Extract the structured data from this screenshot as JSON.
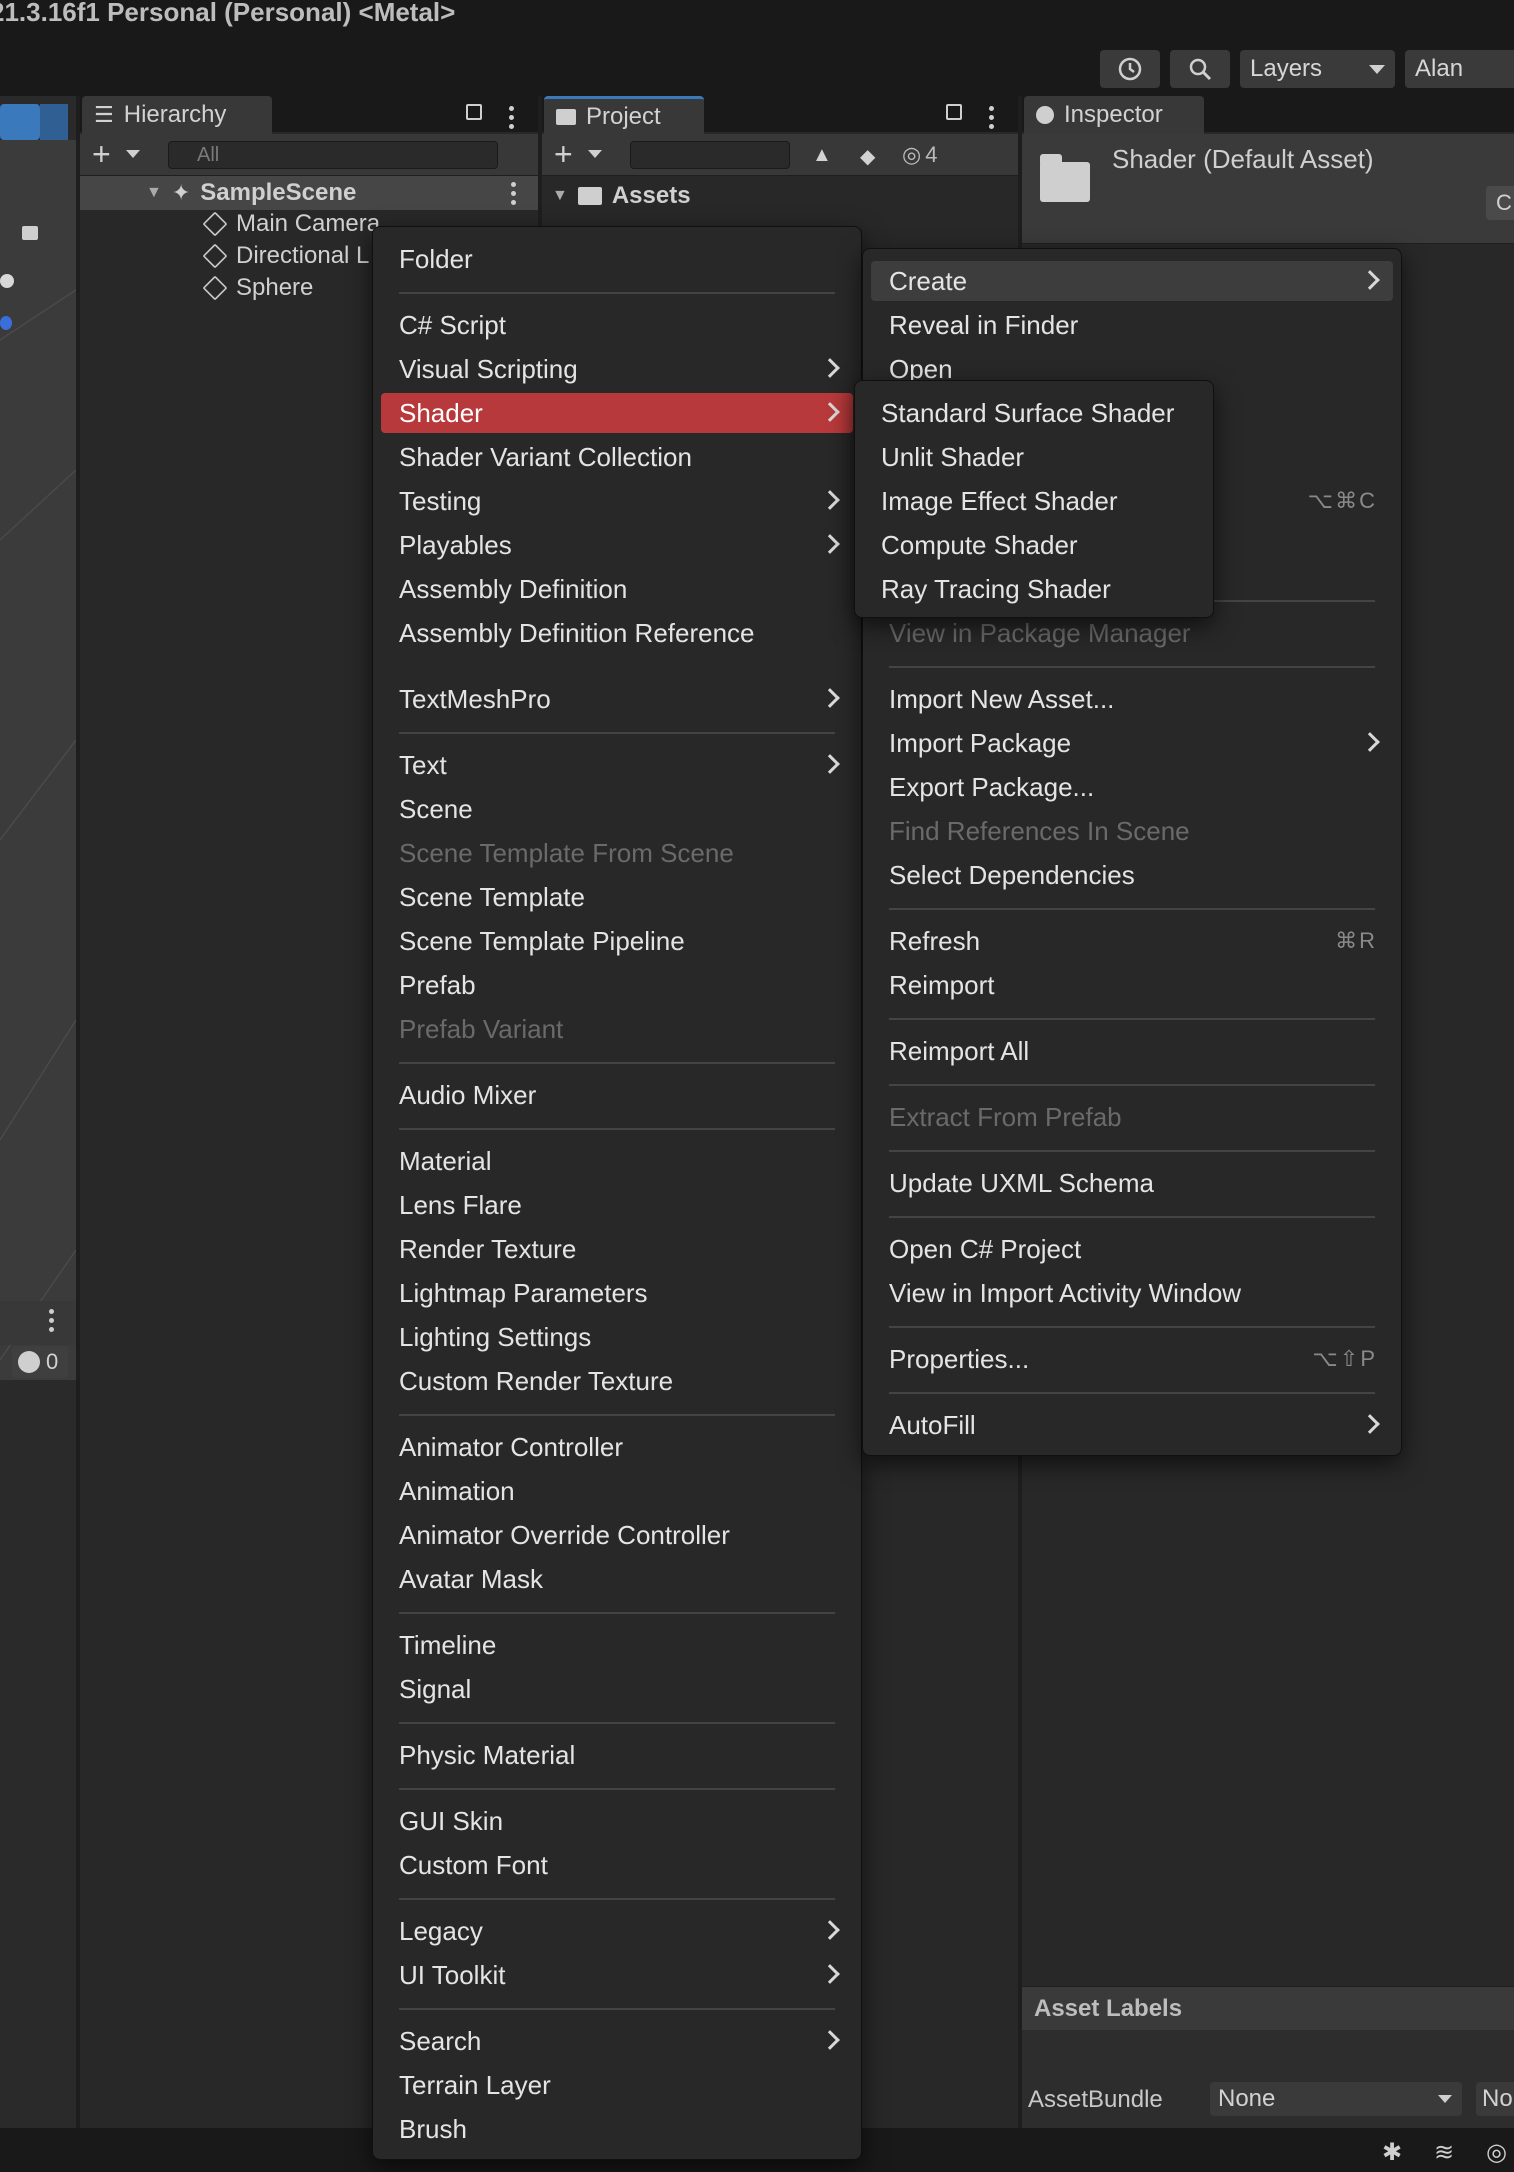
{
  "window": {
    "title": "21.3.16f1 Personal (Personal) <Metal>"
  },
  "toolbar": {
    "layers_label": "Layers",
    "account_label": "Alan"
  },
  "hierarchy": {
    "tab_label": "Hierarchy",
    "search_placeholder": "All",
    "scene": "SampleScene",
    "items": [
      "Main Camera",
      "Directional L",
      "Sphere"
    ]
  },
  "project": {
    "tab_label": "Project",
    "visible_count": "4",
    "root_folder": "Assets"
  },
  "inspector": {
    "tab_label": "Inspector",
    "asset_title": "Shader (Default Asset)",
    "open_button": "C",
    "asset_labels_header": "Asset Labels",
    "assetbundle_label": "AssetBundle",
    "assetbundle_value": "None",
    "assetbundle_variant": "No"
  },
  "console": {
    "warning_count": "0"
  },
  "create_menu": {
    "items": [
      {
        "label": "Folder"
      },
      {
        "label": "C# Script"
      },
      {
        "label": "Visual Scripting",
        "submenu": true
      },
      {
        "label": "Shader",
        "submenu": true,
        "highlighted": true
      },
      {
        "label": "Shader Variant Collection"
      },
      {
        "label": "Testing",
        "submenu": true
      },
      {
        "label": "Playables",
        "submenu": true
      },
      {
        "label": "Assembly Definition"
      },
      {
        "label": "Assembly Definition Reference"
      },
      {
        "label": "TextMeshPro",
        "submenu": true
      },
      {
        "label": "Text",
        "submenu": true
      },
      {
        "label": "Scene"
      },
      {
        "label": "Scene Template From Scene",
        "disabled": true
      },
      {
        "label": "Scene Template"
      },
      {
        "label": "Scene Template Pipeline"
      },
      {
        "label": "Prefab"
      },
      {
        "label": "Prefab Variant",
        "disabled": true
      },
      {
        "label": "Audio Mixer"
      },
      {
        "label": "Material"
      },
      {
        "label": "Lens Flare"
      },
      {
        "label": "Render Texture"
      },
      {
        "label": "Lightmap Parameters"
      },
      {
        "label": "Lighting Settings"
      },
      {
        "label": "Custom Render Texture"
      },
      {
        "label": "Animator Controller"
      },
      {
        "label": "Animation"
      },
      {
        "label": "Animator Override Controller"
      },
      {
        "label": "Avatar Mask"
      },
      {
        "label": "Timeline"
      },
      {
        "label": "Signal"
      },
      {
        "label": "Physic Material"
      },
      {
        "label": "GUI Skin"
      },
      {
        "label": "Custom Font"
      },
      {
        "label": "Legacy",
        "submenu": true
      },
      {
        "label": "UI Toolkit",
        "submenu": true
      },
      {
        "label": "Search",
        "submenu": true
      },
      {
        "label": "Terrain Layer"
      },
      {
        "label": "Brush"
      }
    ]
  },
  "context_menu": {
    "items": [
      {
        "label": "Create",
        "submenu": true,
        "hovered": true
      },
      {
        "label": "Reveal in Finder"
      },
      {
        "label": "Open"
      },
      {
        "label": "",
        "shortcut": "⌥⌘C"
      },
      {
        "label": "View in Package Manager",
        "disabled": true
      },
      {
        "label": "Import New Asset..."
      },
      {
        "label": "Import Package",
        "submenu": true
      },
      {
        "label": "Export Package..."
      },
      {
        "label": "Find References In Scene",
        "disabled": true
      },
      {
        "label": "Select Dependencies"
      },
      {
        "label": "Refresh",
        "shortcut": "⌘R"
      },
      {
        "label": "Reimport"
      },
      {
        "label": "Reimport All"
      },
      {
        "label": "Extract From Prefab",
        "disabled": true
      },
      {
        "label": "Update UXML Schema"
      },
      {
        "label": "Open C# Project"
      },
      {
        "label": "View in Import Activity Window"
      },
      {
        "label": "Properties...",
        "shortcut": "⌥⇧P"
      },
      {
        "label": "AutoFill",
        "submenu": true
      }
    ]
  },
  "shader_submenu": {
    "items": [
      {
        "label": "Standard Surface Shader"
      },
      {
        "label": "Unlit Shader"
      },
      {
        "label": "Image Effect Shader"
      },
      {
        "label": "Compute Shader"
      },
      {
        "label": "Ray Tracing Shader"
      }
    ]
  },
  "colors": {
    "highlight": "#b8393b",
    "menu_bg": "#282828",
    "accent_blue": "#3a79bb"
  }
}
